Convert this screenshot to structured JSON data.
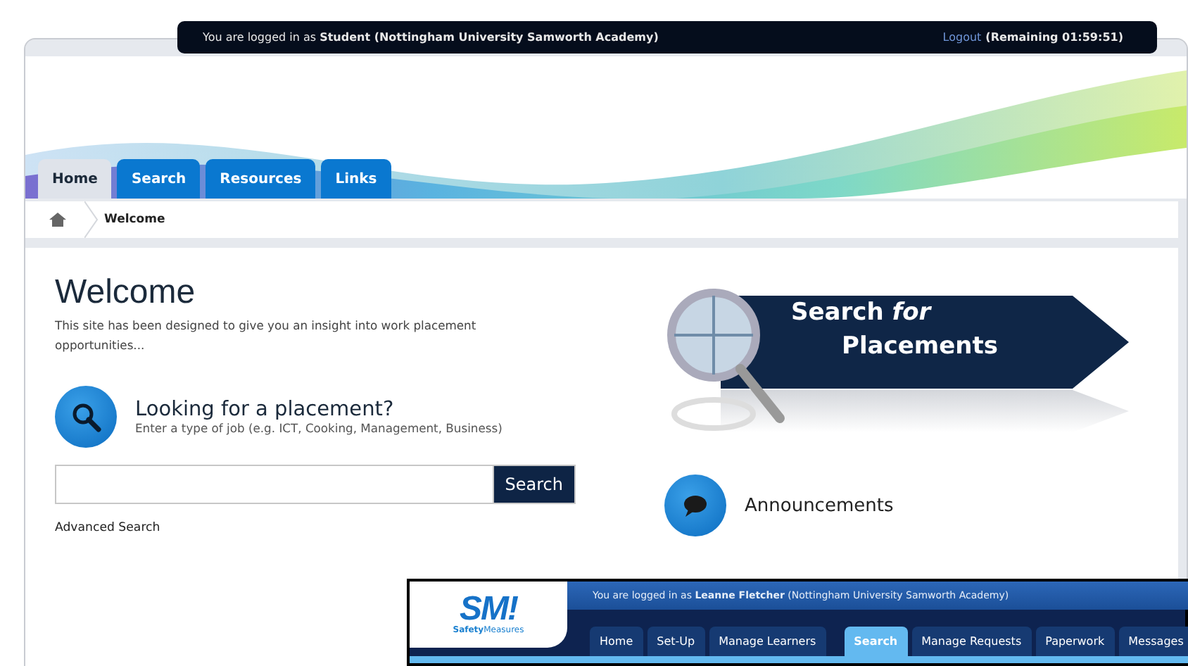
{
  "top_bar": {
    "login_text": "You are logged in as **Student (Nottingham University Samworth Academy)**",
    "logout_link": "Logout",
    "remaining": "(Remaining 01:59:51)"
  },
  "tabs": [
    {
      "label": "Home",
      "selected": true
    },
    {
      "label": "Search",
      "selected": false
    },
    {
      "label": "Resources",
      "selected": false
    },
    {
      "label": "Links",
      "selected": false
    }
  ],
  "breadcrumb": {
    "current": "Welcome"
  },
  "welcome": {
    "title": "Welcome",
    "intro": "This site has been designed to give you an insight into work placement opportunities..."
  },
  "placement_search": {
    "heading": "Looking for a placement?",
    "hint": "Enter a type of job (e.g. ICT, Cooking, Management, Business)",
    "button": "Search",
    "advanced_link": "Advanced Search"
  },
  "banner": {
    "line1": "Search *for*",
    "line2": "Placements"
  },
  "announcements": {
    "heading": "Announcements"
  },
  "overlay_window": {
    "logo": "SM!",
    "logo_caption": "**Safety**Measures",
    "login_text": "You are logged in as **Leanne Fletcher** (Nottingham University Samworth Academy)",
    "tabs": [
      {
        "label": "Home",
        "selected": false
      },
      {
        "label": "Set-Up",
        "selected": false
      },
      {
        "label": "Manage Learners",
        "selected": false
      },
      {
        "label": "Search",
        "selected": true
      },
      {
        "label": "Manage Requests",
        "selected": false
      },
      {
        "label": "Paperwork",
        "selected": false
      },
      {
        "label": "Messages",
        "selected": false
      }
    ]
  }
}
